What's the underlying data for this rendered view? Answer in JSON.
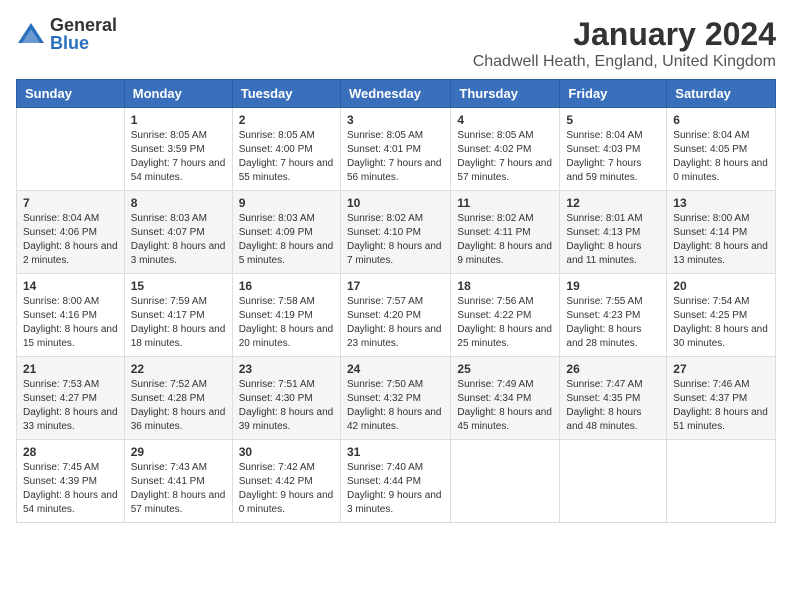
{
  "logo": {
    "text_general": "General",
    "text_blue": "Blue"
  },
  "title": "January 2024",
  "location": "Chadwell Heath, England, United Kingdom",
  "days_of_week": [
    "Sunday",
    "Monday",
    "Tuesday",
    "Wednesday",
    "Thursday",
    "Friday",
    "Saturday"
  ],
  "weeks": [
    [
      {
        "day": "",
        "sunrise": "",
        "sunset": "",
        "daylight": ""
      },
      {
        "day": "1",
        "sunrise": "Sunrise: 8:05 AM",
        "sunset": "Sunset: 3:59 PM",
        "daylight": "Daylight: 7 hours and 54 minutes."
      },
      {
        "day": "2",
        "sunrise": "Sunrise: 8:05 AM",
        "sunset": "Sunset: 4:00 PM",
        "daylight": "Daylight: 7 hours and 55 minutes."
      },
      {
        "day": "3",
        "sunrise": "Sunrise: 8:05 AM",
        "sunset": "Sunset: 4:01 PM",
        "daylight": "Daylight: 7 hours and 56 minutes."
      },
      {
        "day": "4",
        "sunrise": "Sunrise: 8:05 AM",
        "sunset": "Sunset: 4:02 PM",
        "daylight": "Daylight: 7 hours and 57 minutes."
      },
      {
        "day": "5",
        "sunrise": "Sunrise: 8:04 AM",
        "sunset": "Sunset: 4:03 PM",
        "daylight": "Daylight: 7 hours and 59 minutes."
      },
      {
        "day": "6",
        "sunrise": "Sunrise: 8:04 AM",
        "sunset": "Sunset: 4:05 PM",
        "daylight": "Daylight: 8 hours and 0 minutes."
      }
    ],
    [
      {
        "day": "7",
        "sunrise": "Sunrise: 8:04 AM",
        "sunset": "Sunset: 4:06 PM",
        "daylight": "Daylight: 8 hours and 2 minutes."
      },
      {
        "day": "8",
        "sunrise": "Sunrise: 8:03 AM",
        "sunset": "Sunset: 4:07 PM",
        "daylight": "Daylight: 8 hours and 3 minutes."
      },
      {
        "day": "9",
        "sunrise": "Sunrise: 8:03 AM",
        "sunset": "Sunset: 4:09 PM",
        "daylight": "Daylight: 8 hours and 5 minutes."
      },
      {
        "day": "10",
        "sunrise": "Sunrise: 8:02 AM",
        "sunset": "Sunset: 4:10 PM",
        "daylight": "Daylight: 8 hours and 7 minutes."
      },
      {
        "day": "11",
        "sunrise": "Sunrise: 8:02 AM",
        "sunset": "Sunset: 4:11 PM",
        "daylight": "Daylight: 8 hours and 9 minutes."
      },
      {
        "day": "12",
        "sunrise": "Sunrise: 8:01 AM",
        "sunset": "Sunset: 4:13 PM",
        "daylight": "Daylight: 8 hours and 11 minutes."
      },
      {
        "day": "13",
        "sunrise": "Sunrise: 8:00 AM",
        "sunset": "Sunset: 4:14 PM",
        "daylight": "Daylight: 8 hours and 13 minutes."
      }
    ],
    [
      {
        "day": "14",
        "sunrise": "Sunrise: 8:00 AM",
        "sunset": "Sunset: 4:16 PM",
        "daylight": "Daylight: 8 hours and 15 minutes."
      },
      {
        "day": "15",
        "sunrise": "Sunrise: 7:59 AM",
        "sunset": "Sunset: 4:17 PM",
        "daylight": "Daylight: 8 hours and 18 minutes."
      },
      {
        "day": "16",
        "sunrise": "Sunrise: 7:58 AM",
        "sunset": "Sunset: 4:19 PM",
        "daylight": "Daylight: 8 hours and 20 minutes."
      },
      {
        "day": "17",
        "sunrise": "Sunrise: 7:57 AM",
        "sunset": "Sunset: 4:20 PM",
        "daylight": "Daylight: 8 hours and 23 minutes."
      },
      {
        "day": "18",
        "sunrise": "Sunrise: 7:56 AM",
        "sunset": "Sunset: 4:22 PM",
        "daylight": "Daylight: 8 hours and 25 minutes."
      },
      {
        "day": "19",
        "sunrise": "Sunrise: 7:55 AM",
        "sunset": "Sunset: 4:23 PM",
        "daylight": "Daylight: 8 hours and 28 minutes."
      },
      {
        "day": "20",
        "sunrise": "Sunrise: 7:54 AM",
        "sunset": "Sunset: 4:25 PM",
        "daylight": "Daylight: 8 hours and 30 minutes."
      }
    ],
    [
      {
        "day": "21",
        "sunrise": "Sunrise: 7:53 AM",
        "sunset": "Sunset: 4:27 PM",
        "daylight": "Daylight: 8 hours and 33 minutes."
      },
      {
        "day": "22",
        "sunrise": "Sunrise: 7:52 AM",
        "sunset": "Sunset: 4:28 PM",
        "daylight": "Daylight: 8 hours and 36 minutes."
      },
      {
        "day": "23",
        "sunrise": "Sunrise: 7:51 AM",
        "sunset": "Sunset: 4:30 PM",
        "daylight": "Daylight: 8 hours and 39 minutes."
      },
      {
        "day": "24",
        "sunrise": "Sunrise: 7:50 AM",
        "sunset": "Sunset: 4:32 PM",
        "daylight": "Daylight: 8 hours and 42 minutes."
      },
      {
        "day": "25",
        "sunrise": "Sunrise: 7:49 AM",
        "sunset": "Sunset: 4:34 PM",
        "daylight": "Daylight: 8 hours and 45 minutes."
      },
      {
        "day": "26",
        "sunrise": "Sunrise: 7:47 AM",
        "sunset": "Sunset: 4:35 PM",
        "daylight": "Daylight: 8 hours and 48 minutes."
      },
      {
        "day": "27",
        "sunrise": "Sunrise: 7:46 AM",
        "sunset": "Sunset: 4:37 PM",
        "daylight": "Daylight: 8 hours and 51 minutes."
      }
    ],
    [
      {
        "day": "28",
        "sunrise": "Sunrise: 7:45 AM",
        "sunset": "Sunset: 4:39 PM",
        "daylight": "Daylight: 8 hours and 54 minutes."
      },
      {
        "day": "29",
        "sunrise": "Sunrise: 7:43 AM",
        "sunset": "Sunset: 4:41 PM",
        "daylight": "Daylight: 8 hours and 57 minutes."
      },
      {
        "day": "30",
        "sunrise": "Sunrise: 7:42 AM",
        "sunset": "Sunset: 4:42 PM",
        "daylight": "Daylight: 9 hours and 0 minutes."
      },
      {
        "day": "31",
        "sunrise": "Sunrise: 7:40 AM",
        "sunset": "Sunset: 4:44 PM",
        "daylight": "Daylight: 9 hours and 3 minutes."
      },
      {
        "day": "",
        "sunrise": "",
        "sunset": "",
        "daylight": ""
      },
      {
        "day": "",
        "sunrise": "",
        "sunset": "",
        "daylight": ""
      },
      {
        "day": "",
        "sunrise": "",
        "sunset": "",
        "daylight": ""
      }
    ]
  ]
}
